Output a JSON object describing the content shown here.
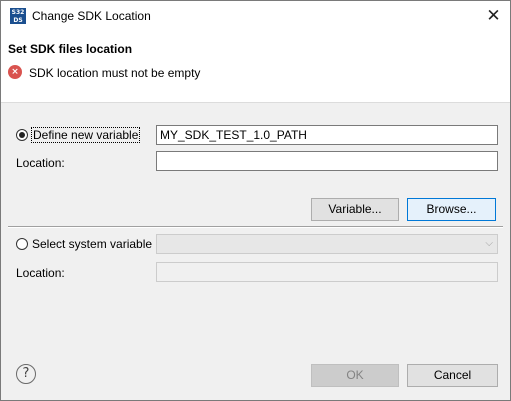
{
  "window": {
    "title": "Change SDK Location",
    "app_icon_text_1": "S32",
    "app_icon_text_2": "DS",
    "close_glyph": "✕"
  },
  "header": {
    "title": "Set SDK files location",
    "error_message": "SDK location must not be empty",
    "error_glyph": "×"
  },
  "define_variable": {
    "label": "Define new variable",
    "selected": true,
    "value": "MY_SDK_TEST_1.0_PATH",
    "location_label": "Location:",
    "location_value": "",
    "variable_button": "Variable...",
    "browse_button": "Browse..."
  },
  "system_variable": {
    "label": "Select system variable",
    "selected": false,
    "selected_value": "",
    "location_label": "Location:",
    "location_value": "",
    "dropdown_icon": "chevron-down-icon"
  },
  "footer": {
    "help_glyph": "?",
    "ok_label": "OK",
    "cancel_label": "Cancel"
  },
  "colors": {
    "accent": "#0078d7",
    "error": "#d9534f",
    "app_icon": "#1b4f8f"
  }
}
